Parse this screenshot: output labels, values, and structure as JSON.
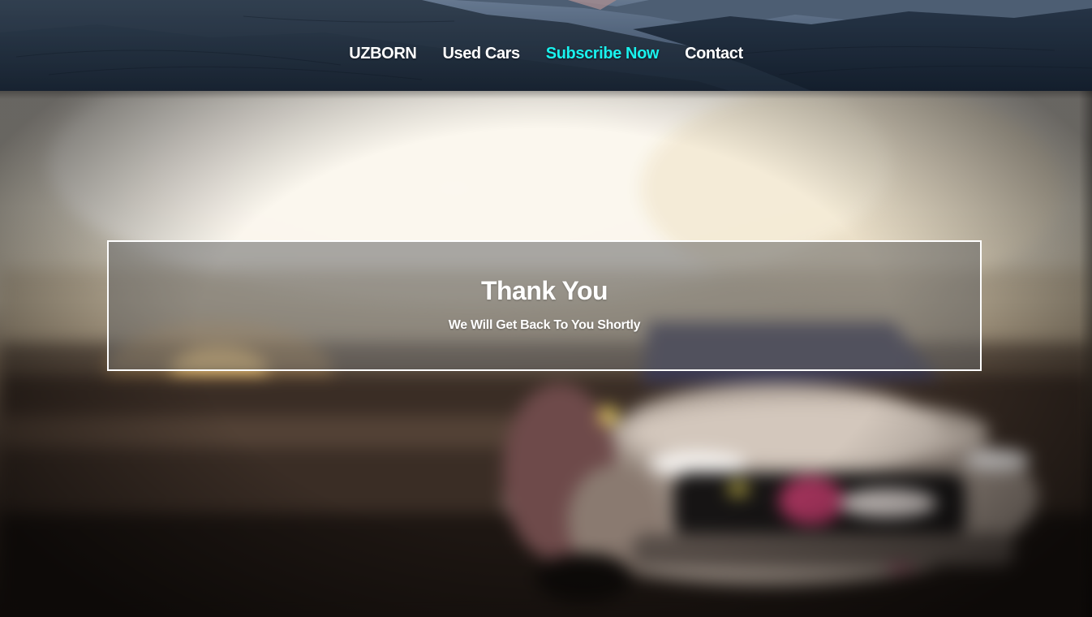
{
  "nav": {
    "items": [
      {
        "label": "UZBORN",
        "active": false
      },
      {
        "label": "Used Cars",
        "active": false
      },
      {
        "label": "Subscribe Now",
        "active": true
      },
      {
        "label": "Contact",
        "active": false
      }
    ],
    "active_color": "#19f2ee",
    "text_color": "#ffffff"
  },
  "hero": {
    "background_description_icon": "blurred-car-photo"
  },
  "thank_you": {
    "title": "Thank You",
    "message": "We Will Get Back To You Shortly",
    "border_color": "#ffffff"
  }
}
